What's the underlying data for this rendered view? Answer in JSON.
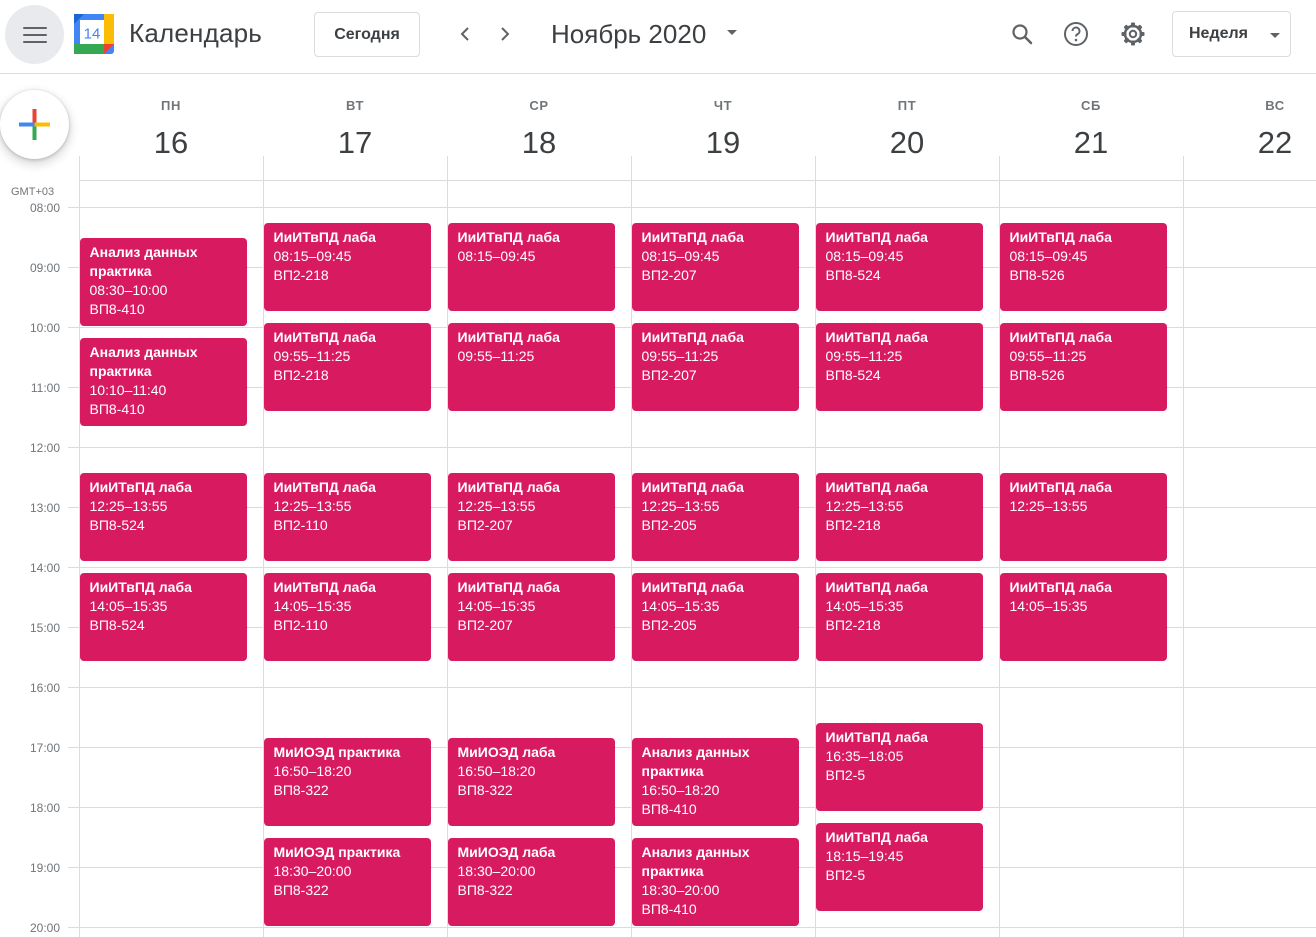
{
  "header": {
    "app_title": "Календарь",
    "logo_day": "14",
    "today_label": "Сегодня",
    "month_title": "Ноябрь 2020",
    "view_label": "Неделя"
  },
  "icons": {
    "menu": "menu-icon",
    "prev": "chevron-left-icon",
    "next": "chevron-right-icon",
    "search": "search-icon",
    "help": "help-icon",
    "settings": "gear-icon",
    "create": "plus-icon"
  },
  "colors": {
    "event": "#d81b60",
    "grid_line": "#dadce0"
  },
  "timezone": "GMT+03",
  "hours": [
    "08:00",
    "09:00",
    "10:00",
    "11:00",
    "12:00",
    "13:00",
    "14:00",
    "15:00",
    "16:00",
    "17:00",
    "18:00",
    "19:00",
    "20:00"
  ],
  "days": [
    {
      "dow": "ПН",
      "num": "16"
    },
    {
      "dow": "ВТ",
      "num": "17"
    },
    {
      "dow": "СР",
      "num": "18"
    },
    {
      "dow": "ЧТ",
      "num": "19"
    },
    {
      "dow": "ПТ",
      "num": "20"
    },
    {
      "dow": "СБ",
      "num": "21"
    },
    {
      "dow": "ВС",
      "num": "22"
    }
  ],
  "events": [
    {
      "day": 0,
      "title": "Анализ данных практика",
      "time": "08:30–10:00",
      "room": "ВП8-410"
    },
    {
      "day": 0,
      "title": "Анализ данных практика",
      "time": "10:10–11:40",
      "room": "ВП8-410"
    },
    {
      "day": 0,
      "title": "ИиИТвПД лаба",
      "time": "12:25–13:55",
      "room": "ВП8-524"
    },
    {
      "day": 0,
      "title": "ИиИТвПД лаба",
      "time": "14:05–15:35",
      "room": "ВП8-524"
    },
    {
      "day": 1,
      "title": "ИиИТвПД лаба",
      "time": "08:15–09:45",
      "room": "ВП2-218"
    },
    {
      "day": 1,
      "title": "ИиИТвПД лаба",
      "time": "09:55–11:25",
      "room": "ВП2-218"
    },
    {
      "day": 1,
      "title": "ИиИТвПД лаба",
      "time": "12:25–13:55",
      "room": "ВП2-110"
    },
    {
      "day": 1,
      "title": "ИиИТвПД лаба",
      "time": "14:05–15:35",
      "room": "ВП2-110"
    },
    {
      "day": 1,
      "title": "МиИОЭД практика",
      "time": "16:50–18:20",
      "room": "ВП8-322"
    },
    {
      "day": 1,
      "title": "МиИОЭД практика",
      "time": "18:30–20:00",
      "room": "ВП8-322"
    },
    {
      "day": 2,
      "title": "ИиИТвПД лаба",
      "time": "08:15–09:45",
      "room": ""
    },
    {
      "day": 2,
      "title": "ИиИТвПД лаба",
      "time": "09:55–11:25",
      "room": ""
    },
    {
      "day": 2,
      "title": "ИиИТвПД лаба",
      "time": "12:25–13:55",
      "room": "ВП2-207"
    },
    {
      "day": 2,
      "title": "ИиИТвПД лаба",
      "time": "14:05–15:35",
      "room": "ВП2-207"
    },
    {
      "day": 2,
      "title": "МиИОЭД лаба",
      "time": "16:50–18:20",
      "room": "ВП8-322"
    },
    {
      "day": 2,
      "title": "МиИОЭД лаба",
      "time": "18:30–20:00",
      "room": "ВП8-322"
    },
    {
      "day": 3,
      "title": "ИиИТвПД лаба",
      "time": "08:15–09:45",
      "room": "ВП2-207"
    },
    {
      "day": 3,
      "title": "ИиИТвПД лаба",
      "time": "09:55–11:25",
      "room": "ВП2-207"
    },
    {
      "day": 3,
      "title": "ИиИТвПД лаба",
      "time": "12:25–13:55",
      "room": "ВП2-205"
    },
    {
      "day": 3,
      "title": "ИиИТвПД лаба",
      "time": "14:05–15:35",
      "room": "ВП2-205"
    },
    {
      "day": 3,
      "title": "Анализ данных практика",
      "time": "16:50–18:20",
      "room": "ВП8-410"
    },
    {
      "day": 3,
      "title": "Анализ данных практика",
      "time": "18:30–20:00",
      "room": "ВП8-410"
    },
    {
      "day": 4,
      "title": "ИиИТвПД лаба",
      "time": "08:15–09:45",
      "room": "ВП8-524"
    },
    {
      "day": 4,
      "title": "ИиИТвПД лаба",
      "time": "09:55–11:25",
      "room": "ВП8-524"
    },
    {
      "day": 4,
      "title": "ИиИТвПД лаба",
      "time": "12:25–13:55",
      "room": "ВП2-218"
    },
    {
      "day": 4,
      "title": "ИиИТвПД лаба",
      "time": "14:05–15:35",
      "room": "ВП2-218"
    },
    {
      "day": 4,
      "title": "ИиИТвПД лаба",
      "time": "16:35–18:05",
      "room": "ВП2-5"
    },
    {
      "day": 4,
      "title": "ИиИТвПД лаба",
      "time": "18:15–19:45",
      "room": "ВП2-5"
    },
    {
      "day": 5,
      "title": "ИиИТвПД лаба",
      "time": "08:15–09:45",
      "room": "ВП8-526"
    },
    {
      "day": 5,
      "title": "ИиИТвПД лаба",
      "time": "09:55–11:25",
      "room": "ВП8-526"
    },
    {
      "day": 5,
      "title": "ИиИТвПД лаба",
      "time": "12:25–13:55",
      "room": ""
    },
    {
      "day": 5,
      "title": "ИиИТвПД лаба",
      "time": "14:05–15:35",
      "room": ""
    }
  ]
}
